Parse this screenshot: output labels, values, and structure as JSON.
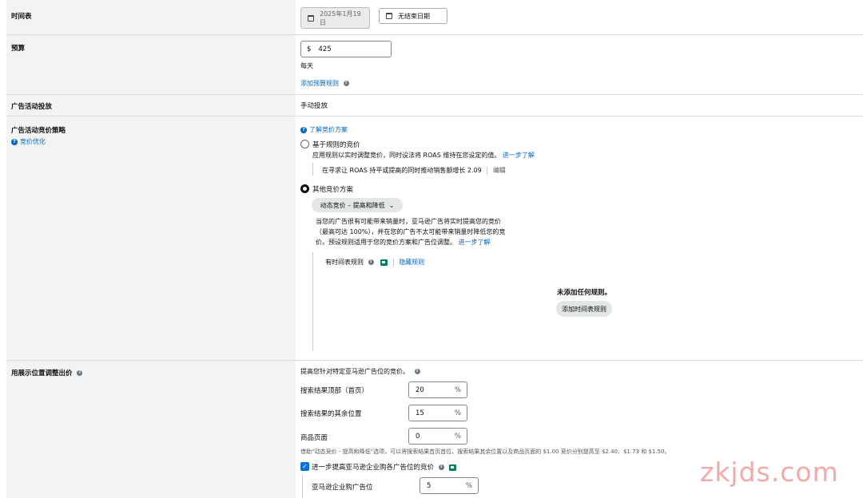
{
  "schedule": {
    "label": "时间表",
    "start_date_line1": "2025年1月19",
    "start_date_line2": "日",
    "end_date": "无结束日期"
  },
  "budget": {
    "label": "预算",
    "currency": "$",
    "value": "425",
    "period": "每天",
    "add_rule_link": "添加预算规则"
  },
  "delivery": {
    "label": "广告活动投放",
    "value": "手动投放"
  },
  "bidding": {
    "label": "广告活动竞价策略",
    "optimize_link": "竞价优化",
    "learn_link": "了解竞价方案",
    "rule_based": {
      "label": "基于规则的竞价",
      "desc": "应用规则以实时调整竞价，同时设法将 ROAS 维持在您设定的值。",
      "learn_more": "进一步了解",
      "detail": "在寻求让 ROAS 持平或提高的同时推动销售额增长 2.09",
      "edit": "编辑"
    },
    "other": {
      "label": "其他竞价方案",
      "dropdown": "动态竞价 – 提高和降低",
      "desc_line1": "当您的广告很有可能带来销量时，亚马逊广告将实时提高您的竞价",
      "desc_line2": "（最高可达 100%），并在您的广告不太可能带来销量时降低您的竞",
      "desc_line3": "价。预设规则适用于您的竞价方案和广告位调整。",
      "learn_more": "进一步了解"
    },
    "schedule_rules": {
      "label": "有时间表规则",
      "hide": "隐藏规则",
      "empty": "未添加任何规则。",
      "add_button": "添加时间表规则"
    }
  },
  "placement": {
    "label": "用展示位置调整出价",
    "intro": "提高您针对特定亚马逊广告位的竞价。",
    "rows": [
      {
        "label": "搜索结果顶部（首页）",
        "value": "20",
        "unit": "%"
      },
      {
        "label": "搜索结果的其余位置",
        "value": "15",
        "unit": "%"
      },
      {
        "label": "商品页面",
        "value": "0",
        "unit": "%"
      }
    ],
    "note": "借助“动态竞价 - 提高和降低”选项，可以将搜索结果首页首位、搜索结果其余位置以及商品页面的 $1.00 竞价分别提高至 $2.40、$1.73 和 $1.50。",
    "business": {
      "checkbox_label": "进一步提高亚马逊企业购各广告位的竞价",
      "row_label": "亚马逊企业购广告位",
      "value": "5",
      "unit": "%"
    }
  },
  "watermark": "zkjds.com"
}
